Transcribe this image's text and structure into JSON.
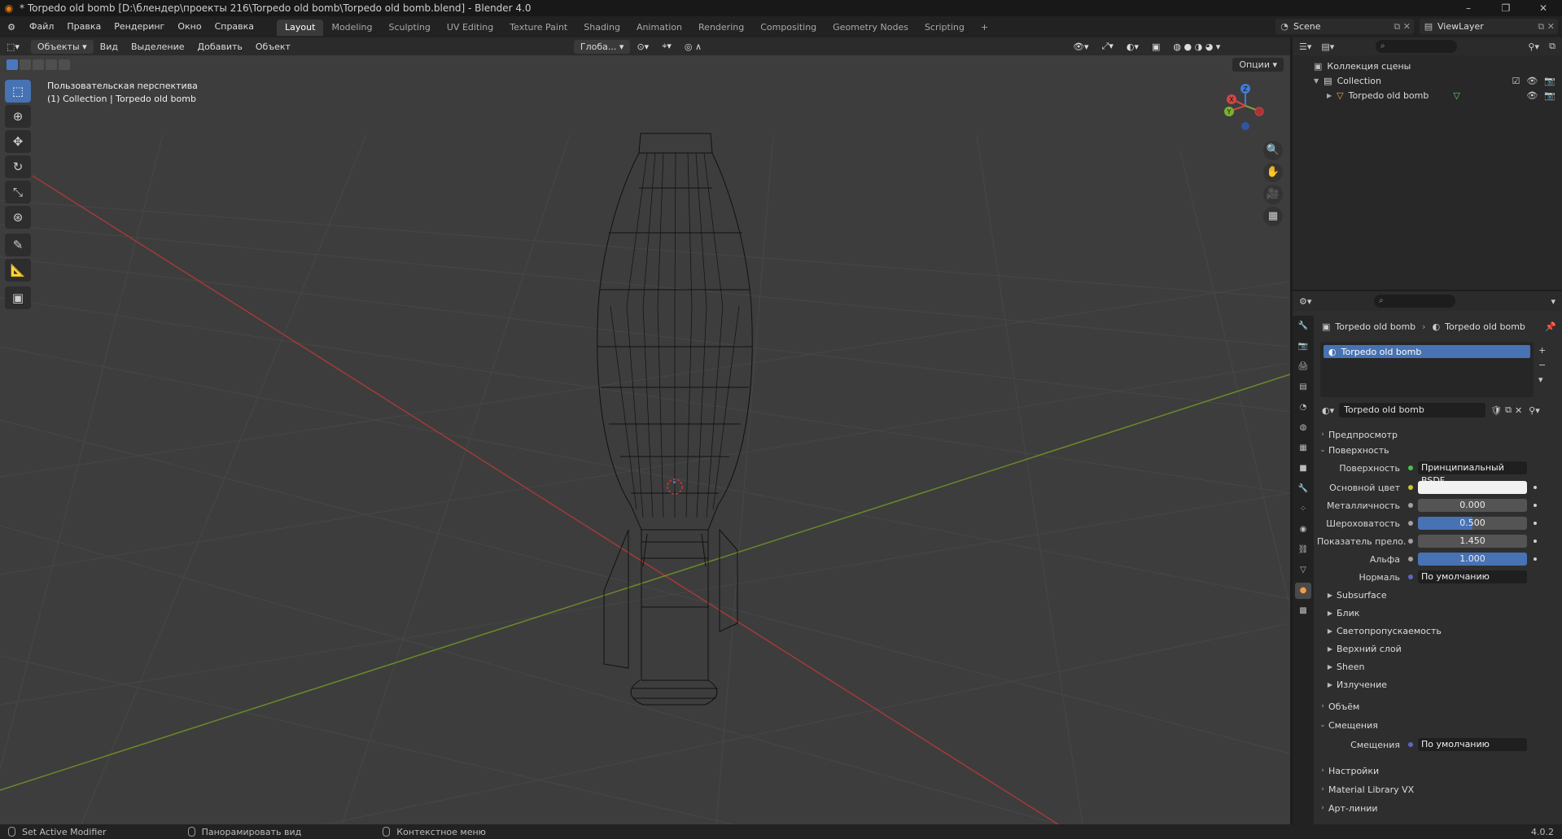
{
  "window": {
    "title": "* Torpedo old bomb [D:\\блендер\\проекты 216\\Torpedo old bomb\\Torpedo old bomb.blend] - Blender 4.0",
    "controls": [
      "–",
      "❐",
      "✕"
    ]
  },
  "menu": [
    "Файл",
    "Правка",
    "Рендеринг",
    "Окно",
    "Справка"
  ],
  "workspaces": [
    "Layout",
    "Modeling",
    "Sculpting",
    "UV Editing",
    "Texture Paint",
    "Shading",
    "Animation",
    "Rendering",
    "Compositing",
    "Geometry Nodes",
    "Scripting"
  ],
  "active_workspace": "Layout",
  "scene": "Scene",
  "view_layer": "ViewLayer",
  "viewport": {
    "mode": "Объекты",
    "header_menu": [
      "Вид",
      "Выделение",
      "Добавить",
      "Объект"
    ],
    "transform_orientation": "Глоба...",
    "options_label": "Опции",
    "overlay_line1": "Пользовательская перспектива",
    "overlay_line2": "(1) Collection | Torpedo old bomb",
    "gizmo_axes": [
      "X",
      "Y",
      "Z"
    ],
    "colors": {
      "background": "#3d3d3d",
      "x_axis": "#a23a3a",
      "y_axis": "#6a8a2a",
      "wire": "#111111",
      "grid": "#474747"
    }
  },
  "tools": [
    "select-box",
    "cursor",
    "move",
    "rotate",
    "scale",
    "transform",
    "annotate",
    "measure",
    "add-cube"
  ],
  "outliner": {
    "root": "Коллекция сцены",
    "collection": "Collection",
    "object": "Torpedo old bomb"
  },
  "properties": {
    "breadcrumb_object": "Torpedo old bomb",
    "breadcrumb_material": "Torpedo old bomb",
    "slot_name": "Torpedo old bomb",
    "material_name": "Torpedo old bomb",
    "panels": {
      "preview": "Предпросмотр",
      "surface": "Поверхность",
      "volume": "Объём",
      "displacement": "Смещения",
      "settings": "Настройки",
      "library": "Material Library VX",
      "lineart": "Арт-линии"
    },
    "fields": [
      {
        "label": "Поверхность",
        "value": "Принципиальный BSDF",
        "style": "dark"
      },
      {
        "label": "Основной цвет",
        "value": "",
        "style": "white"
      },
      {
        "label": "Металличность",
        "value": "0.000",
        "style": "grey"
      },
      {
        "label": "Шероховатость",
        "value": "0.500",
        "style": "blue",
        "fraction": 0.5
      },
      {
        "label": "Показатель прело...",
        "value": "1.450",
        "style": "grey"
      },
      {
        "label": "Альфа",
        "value": "1.000",
        "style": "blue",
        "fraction": 1.0
      },
      {
        "label": "Нормаль",
        "value": "По умолчанию",
        "style": "dark"
      }
    ],
    "subpanels": [
      "Subsurface",
      "Блик",
      "Светопропускаемость",
      "Верхний слой",
      "Sheen",
      "Излучение"
    ],
    "displacement_field": {
      "label": "Смещения",
      "value": "По умолчанию"
    }
  },
  "status": {
    "left": "Set Active Modifier",
    "middle": "Панорамировать вид",
    "right": "Контекстное меню",
    "version": "4.0.2"
  }
}
